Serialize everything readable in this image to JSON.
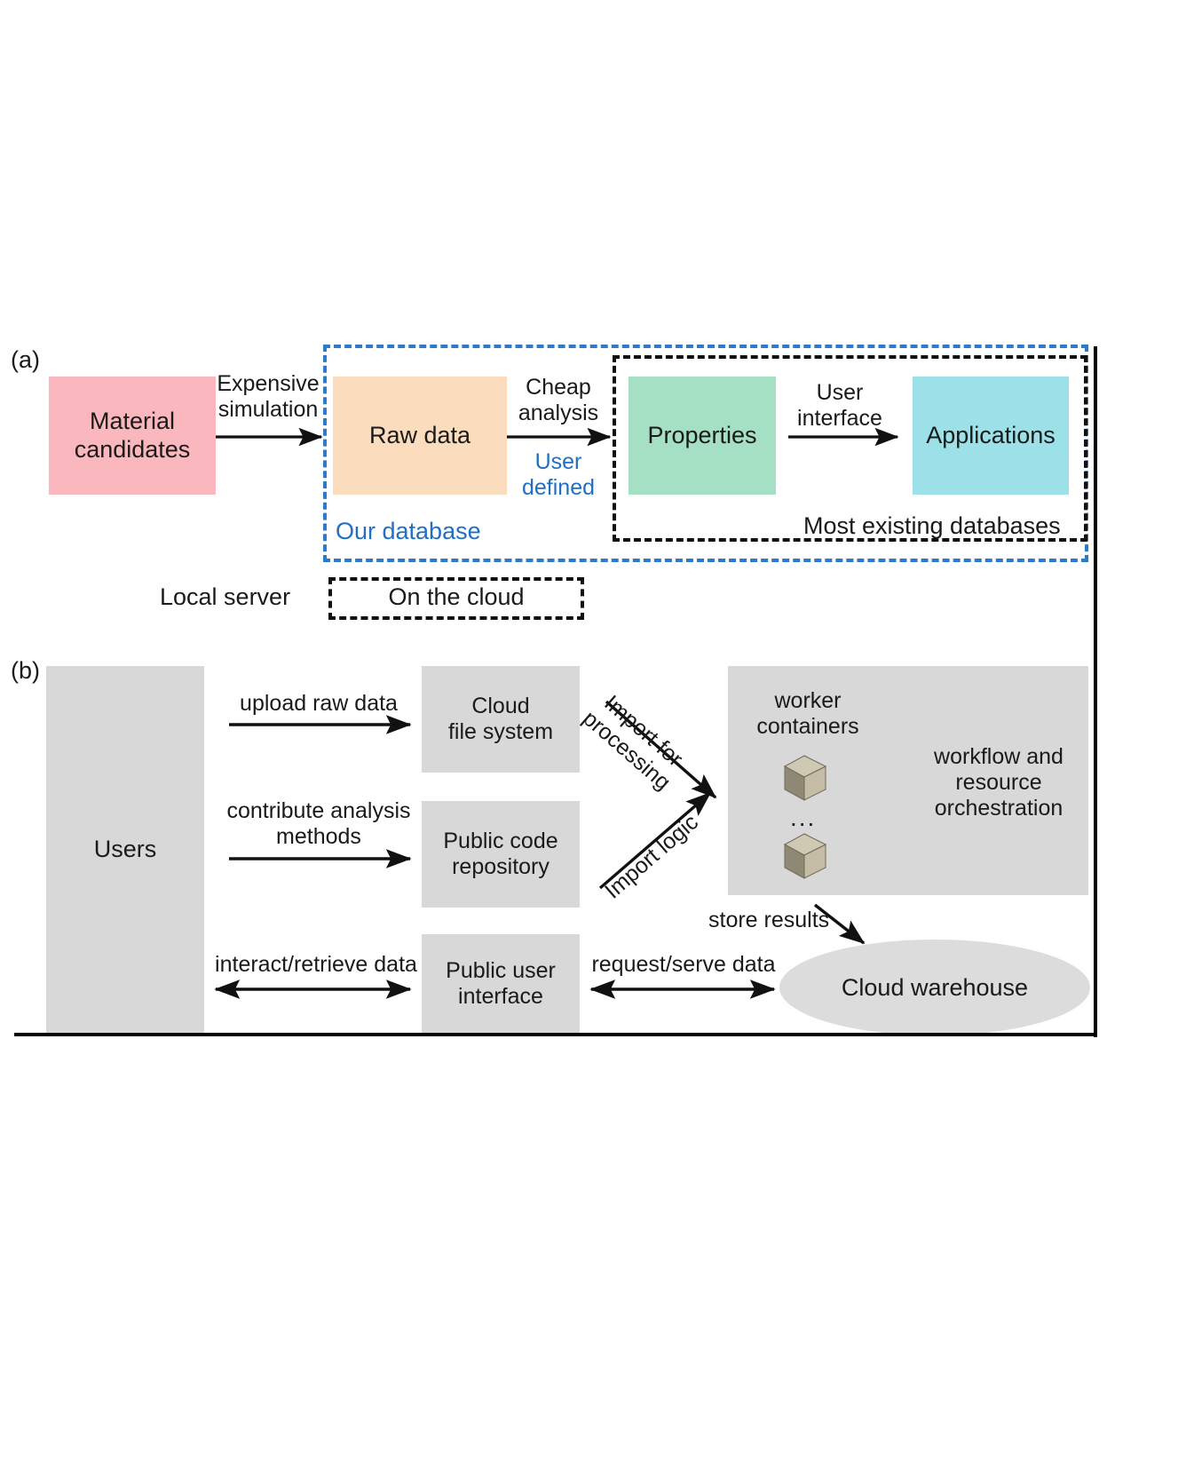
{
  "figure": {
    "panel_a_tag": "(a)",
    "panel_b_tag": "(b)"
  },
  "panel_a": {
    "nodes": [
      {
        "id": "material-candidates",
        "label": "Material\ncandidates",
        "color": "#FAB8BE"
      },
      {
        "id": "raw-data",
        "label": "Raw data",
        "color": "#FBDCBD"
      },
      {
        "id": "properties",
        "label": "Properties",
        "color": "#A5DFC4"
      },
      {
        "id": "applications",
        "label": "Applications",
        "color": "#9CE0E8"
      }
    ],
    "arrows": [
      {
        "id": "expensive-simulation",
        "label": "Expensive\nsimulation",
        "sublabel": ""
      },
      {
        "id": "cheap-analysis",
        "label": "Cheap\nanalysis",
        "sublabel": "User\ndefined"
      },
      {
        "id": "user-interface",
        "label": "User\ninterface",
        "sublabel": ""
      }
    ],
    "our_database_label": "Our database",
    "most_existing_label": "Most existing databases",
    "legend": {
      "local_server": "Local server",
      "on_the_cloud": "On the cloud"
    },
    "colors": {
      "our_database_accent": "#2E79C9",
      "most_existing_accent": "#111111"
    }
  },
  "panel_b": {
    "nodes": [
      {
        "id": "users",
        "label": "Users"
      },
      {
        "id": "cloud-file-system",
        "label": "Cloud\nfile system"
      },
      {
        "id": "public-code-repository",
        "label": "Public code\nrepository"
      },
      {
        "id": "public-user-interface",
        "label": "Public user\ninterface"
      },
      {
        "id": "orchestration-panel",
        "label": "workflow and\nresource\norchestration"
      },
      {
        "id": "cloud-warehouse",
        "label": "Cloud warehouse"
      }
    ],
    "worker_area": {
      "title": "worker\ncontainers",
      "ellipsis": "..."
    },
    "arrows": [
      {
        "id": "upload-raw-data",
        "label": "upload raw data"
      },
      {
        "id": "contribute-analysis",
        "label": "contribute analysis\nmethods"
      },
      {
        "id": "interact-retrieve",
        "label": "interact/retrieve data"
      },
      {
        "id": "import-for-processing",
        "label": "Import for\nprocessing"
      },
      {
        "id": "import-logic",
        "label": "Import logic"
      },
      {
        "id": "store-results",
        "label": "store results"
      },
      {
        "id": "request-serve-data",
        "label": "request/serve data"
      }
    ],
    "colors": {
      "box_fill": "#D8D8D8",
      "ellipse_fill": "#DCDCDC",
      "cube_light": "#C4BCA4",
      "cube_dark": "#8F8874",
      "cube_top": "#CFC8B2"
    }
  }
}
